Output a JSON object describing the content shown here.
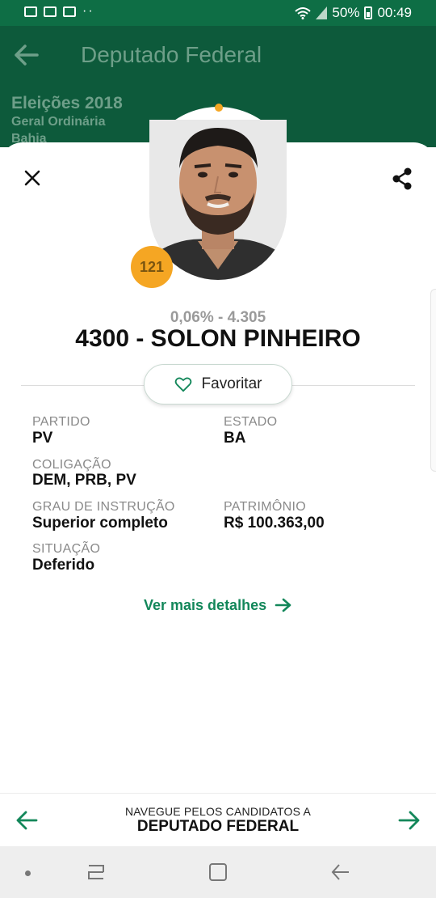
{
  "status_bar": {
    "battery": "50%",
    "time": "00:49"
  },
  "header": {
    "title": "Deputado Federal",
    "election_title": "Eleições 2018",
    "election_type": "Geral Ordinária",
    "election_state": "Bahia"
  },
  "candidate": {
    "rank": "121",
    "votes": "0,06% - 4.305",
    "name": "4300 - SOLON PINHEIRO",
    "favorite_label": "Favoritar",
    "fields": {
      "partido_label": "PARTIDO",
      "partido_value": "PV",
      "estado_label": "ESTADO",
      "estado_value": "BA",
      "coligacao_label": "COLIGAÇÃO",
      "coligacao_value": "DEM, PRB, PV",
      "grau_label": "GRAU DE INSTRUÇÃO",
      "grau_value": "Superior completo",
      "patrimonio_label": "PATRIMÔNIO",
      "patrimonio_value": "R$ 100.363,00",
      "situacao_label": "SITUAÇÃO",
      "situacao_value": "Deferido"
    },
    "more_details": "Ver mais detalhes"
  },
  "bottom_nav": {
    "caption": "NAVEGUE PELOS CANDIDATOS A",
    "role": "DEPUTADO FEDERAL"
  },
  "colors": {
    "header_green": "#0d5a3b",
    "status_green": "#0e6e45",
    "accent_green": "#13875a",
    "badge_orange": "#f5a623"
  },
  "icons": [
    "wifi-icon",
    "signal-icon",
    "battery-icon",
    "back-arrow-icon",
    "close-icon",
    "share-icon",
    "heart-icon",
    "arrow-right-icon",
    "arrow-left-icon"
  ]
}
